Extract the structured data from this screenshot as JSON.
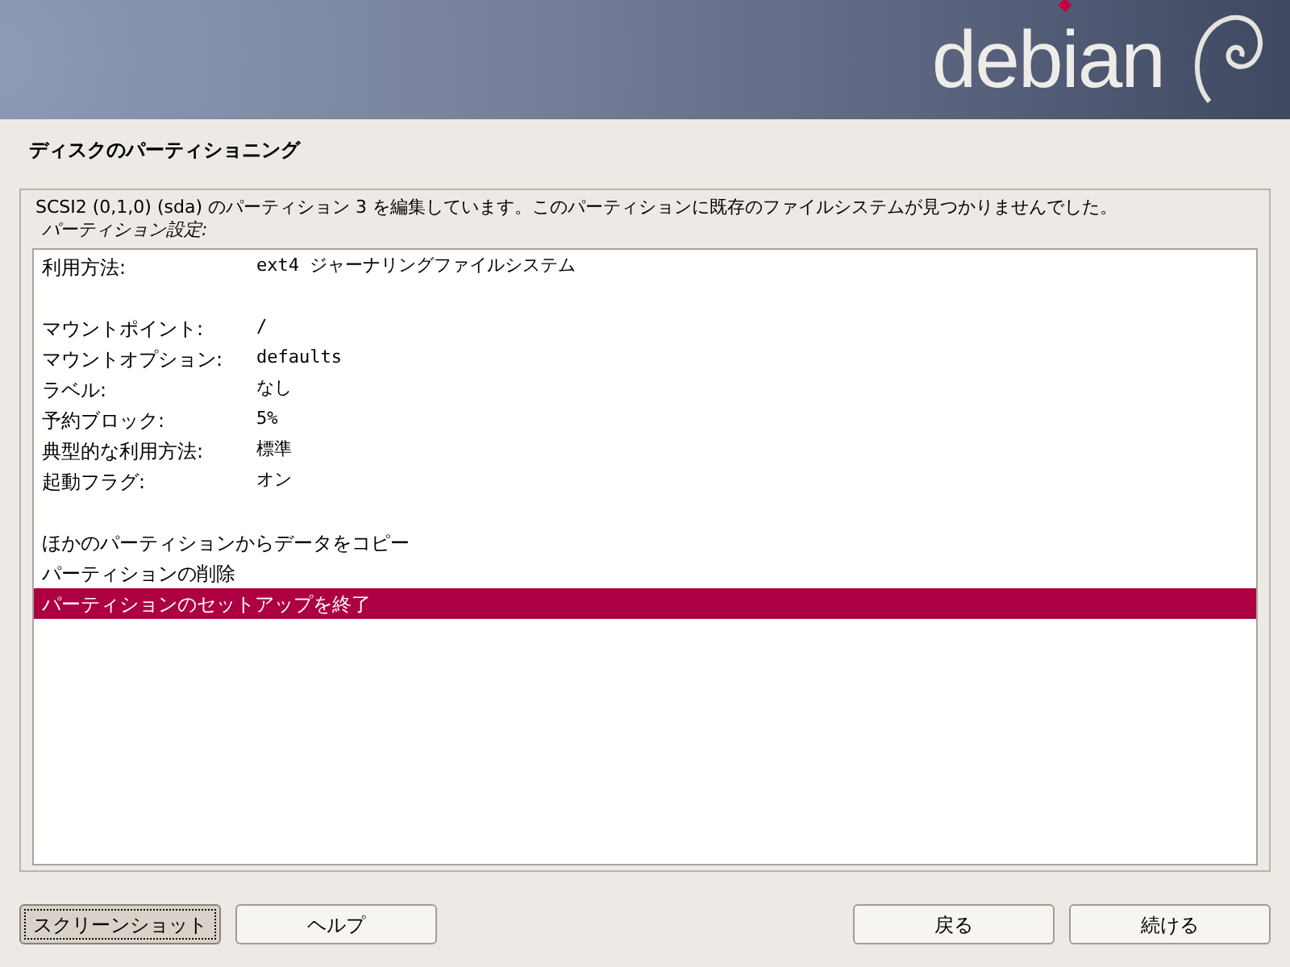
{
  "banner": {
    "logo": "debian"
  },
  "title": "ディスクのパーティショニング",
  "message": "SCSI2 (0,1,0) (sda) のパーティション 3 を編集しています。このパーティションに既存のファイルシステムが見つかりませんでした。",
  "prompt": "パーティション設定:",
  "items": [
    {
      "kind": "setting",
      "label": "利用方法:",
      "value": "ext4 ジャーナリングファイルシステム",
      "selected": false
    },
    {
      "kind": "spacer"
    },
    {
      "kind": "setting",
      "label": "マウントポイント:",
      "value": "/",
      "selected": false
    },
    {
      "kind": "setting",
      "label": "マウントオプション:",
      "value": "defaults",
      "selected": false
    },
    {
      "kind": "setting",
      "label": "ラベル:",
      "value": "なし",
      "selected": false
    },
    {
      "kind": "setting",
      "label": "予約ブロック:",
      "value": "5%",
      "selected": false
    },
    {
      "kind": "setting",
      "label": "典型的な利用方法:",
      "value": "標準",
      "selected": false
    },
    {
      "kind": "setting",
      "label": "起動フラグ:",
      "value": "オン",
      "selected": false
    },
    {
      "kind": "spacer"
    },
    {
      "kind": "action",
      "label": "ほかのパーティションからデータをコピー",
      "selected": false
    },
    {
      "kind": "action",
      "label": "パーティションの削除",
      "selected": false
    },
    {
      "kind": "action",
      "label": "パーティションのセットアップを終了",
      "selected": true
    }
  ],
  "left_buttons": [
    {
      "label": "スクリーンショット",
      "focused": true
    },
    {
      "label": "ヘルプ",
      "focused": false
    }
  ],
  "right_buttons": [
    {
      "label": "戻る",
      "focused": false
    },
    {
      "label": "続ける",
      "focused": false
    }
  ]
}
